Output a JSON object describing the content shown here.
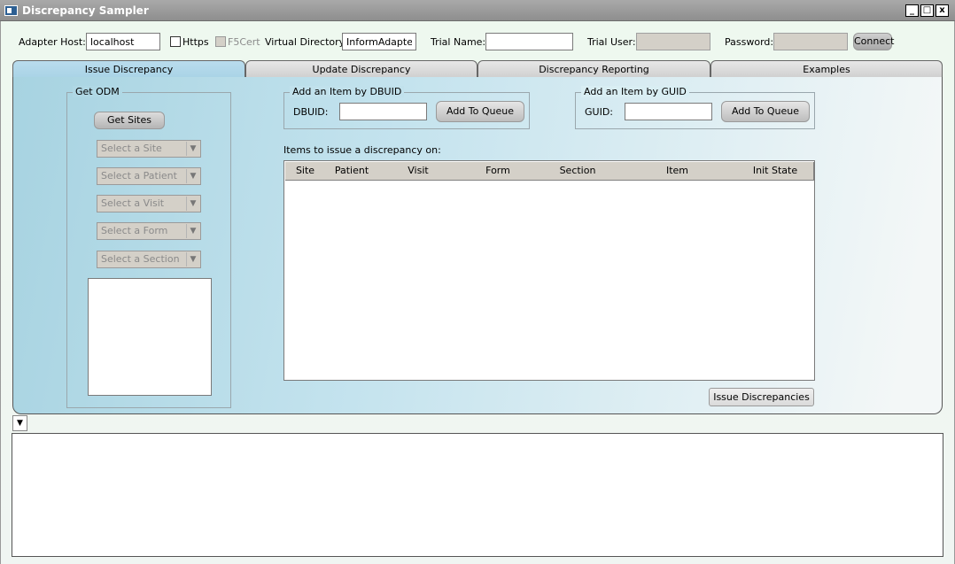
{
  "window": {
    "title": "Discrepancy Sampler",
    "controls": {
      "minimize": "_",
      "maximize": "□",
      "close": "x"
    }
  },
  "connection": {
    "adapter_host_label": "Adapter Host:",
    "adapter_host_value": "localhost",
    "https_label": "Https",
    "f5cert_label": "F5Cert",
    "virtual_dir_label": "Virtual Directory:",
    "virtual_dir_value": "InformAdapter",
    "trial_name_label": "Trial Name:",
    "trial_name_value": "",
    "trial_user_label": "Trial User:",
    "password_label": "Password:",
    "connect_label": "Connect"
  },
  "tabs": [
    {
      "label": "Issue Discrepancy"
    },
    {
      "label": "Update Discrepancy"
    },
    {
      "label": "Discrepancy Reporting"
    },
    {
      "label": "Examples"
    }
  ],
  "odm": {
    "group_label": "Get ODM",
    "get_sites_label": "Get Sites",
    "combos": [
      {
        "placeholder": "Select a Site"
      },
      {
        "placeholder": "Select a Patient"
      },
      {
        "placeholder": "Select a Visit"
      },
      {
        "placeholder": "Select a Form"
      },
      {
        "placeholder": "Select a Section"
      }
    ]
  },
  "dbuid": {
    "group_label": "Add an Item by DBUID",
    "field_label": "DBUID:",
    "value": "",
    "button_label": "Add To Queue"
  },
  "guid": {
    "group_label": "Add an Item by GUID",
    "field_label": "GUID:",
    "value": "",
    "button_label": "Add To Queue"
  },
  "items": {
    "caption": "Items to issue a discrepancy on:",
    "columns": [
      "Site",
      "Patient",
      "Visit",
      "Form",
      "Section",
      "Item",
      "Init State"
    ],
    "rows": []
  },
  "issue_button_label": "Issue Discrepancies",
  "log": {
    "collapse_glyph": "▼",
    "text": ""
  }
}
